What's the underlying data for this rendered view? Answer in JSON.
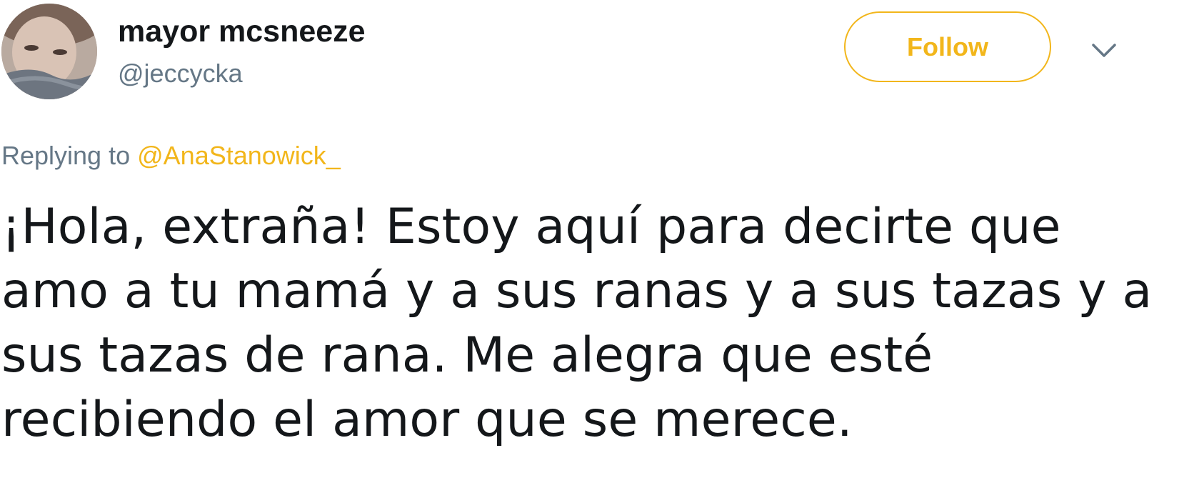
{
  "author": {
    "display_name": "mayor mcsneeze",
    "handle": "@jeccycka",
    "avatar_icon": "profile-photo"
  },
  "actions": {
    "follow_label": "Follow",
    "menu_icon": "chevron-down-icon"
  },
  "reply": {
    "prefix": "Replying to",
    "mention": "@AnaStanowick_"
  },
  "tweet": {
    "lines": [
      "¡Hola, extraña! Estoy aquí para decirte que",
      "amo a tu mamá y a sus ranas y a sus tazas y a",
      "sus tazas de rana. Me alegra que esté",
      "recibiendo el amor que se merece."
    ]
  },
  "colors": {
    "accent": "#f2b61b",
    "text": "#14171a",
    "secondary_text": "#657786"
  }
}
